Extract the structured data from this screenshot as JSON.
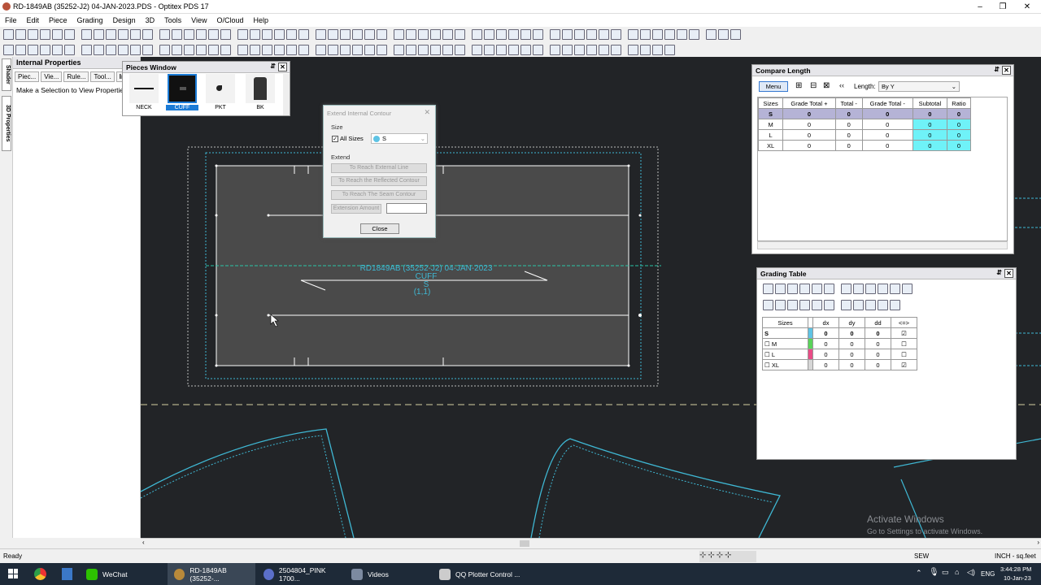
{
  "window": {
    "title": "RD-1849AB (35252-J2) 04-JAN-2023.PDS - Optitex PDS 17"
  },
  "menu": [
    "File",
    "Edit",
    "Piece",
    "Grading",
    "Design",
    "3D",
    "Tools",
    "View",
    "O/Cloud",
    "Help"
  ],
  "left_tabs": [
    "Shader",
    "3D Properties"
  ],
  "internal_properties": {
    "title": "Internal Properties",
    "tabs": [
      "Piec...",
      "Vie...",
      "Rule...",
      "Tool...",
      "Int"
    ],
    "message": "Make a Selection to View Properties"
  },
  "pieces_window": {
    "title": "Pieces Window",
    "pieces": [
      {
        "name": "NECK"
      },
      {
        "name": "CUFF",
        "selected": true
      },
      {
        "name": "PKT"
      },
      {
        "name": "BK"
      }
    ]
  },
  "canvas": {
    "piece_label": "RD1849AB (35252-J2) 04-JAN-2023",
    "piece_name": "CUFF",
    "piece_size": "S",
    "piece_qty": "(1,1)",
    "watermark_title": "Activate Windows",
    "watermark_sub": "Go to Settings to activate Windows."
  },
  "dialog": {
    "title": "Extend Internal Contour",
    "size_group": "Size",
    "all_sizes_label": "All Sizes",
    "all_sizes_checked": true,
    "size_value": "S",
    "extend_group": "Extend",
    "buttons": [
      "To Reach External Line",
      "To Reach the Reflected Contour",
      "To Reach The Seam Contour"
    ],
    "extension_label": "Extension Amount",
    "extension_value": "",
    "close_label": "Close"
  },
  "compare_length": {
    "title": "Compare Length",
    "menu_label": "Menu",
    "length_label": "Length:",
    "length_value": "By Y",
    "columns": [
      "Sizes",
      "Grade Total +",
      "Total -",
      "Grade Total -",
      "Subtotal",
      "Ratio"
    ],
    "rows": [
      [
        "S",
        "0",
        "0",
        "0",
        "0",
        "0"
      ],
      [
        "M",
        "0",
        "0",
        "0",
        "0",
        "0"
      ],
      [
        "L",
        "0",
        "0",
        "0",
        "0",
        "0"
      ],
      [
        "XL",
        "0",
        "0",
        "0",
        "0",
        "0"
      ]
    ]
  },
  "grading_table": {
    "title": "Grading Table",
    "columns": [
      "Sizes",
      "",
      "dx",
      "dy",
      "dd",
      "<=>"
    ],
    "rows": [
      {
        "size": "S",
        "color": "#5fc3e4",
        "dx": "0",
        "dy": "0",
        "dd": "0",
        "checked": true,
        "box": false
      },
      {
        "size": "M",
        "color": "#5ad35a",
        "dx": "0",
        "dy": "0",
        "dd": "0",
        "checked": false,
        "box": true
      },
      {
        "size": "L",
        "color": "#e94c86",
        "dx": "0",
        "dy": "0",
        "dd": "0",
        "checked": false,
        "box": true
      },
      {
        "size": "XL",
        "color": "#d6d6d6",
        "dx": "0",
        "dy": "0",
        "dd": "0",
        "checked": true,
        "box": true
      }
    ]
  },
  "status": {
    "left": "Ready",
    "mode": "SEW",
    "units": "INCH - sq.feet"
  },
  "taskbar": {
    "items": [
      "WeChat",
      "RD-1849AB (35252-...",
      "2504804_PINK 1700...",
      "Videos",
      "QQ Plotter Control ..."
    ],
    "lang": "ENG",
    "time": "3:44:28 PM",
    "date": "10-Jan-23"
  }
}
